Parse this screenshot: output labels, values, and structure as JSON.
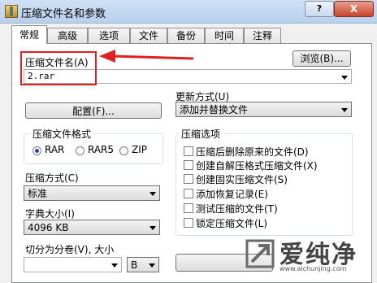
{
  "window": {
    "title": "压缩文件名和参数",
    "help_label": "?",
    "close_label": "X"
  },
  "tabs": [
    "常规",
    "高级",
    "选项",
    "文件",
    "备份",
    "时间",
    "注释"
  ],
  "archive": {
    "label": "压缩文件名(A)",
    "value": "2.rar",
    "browse_label": "浏览(B)..."
  },
  "update_mode": {
    "label": "更新方式(U)",
    "value": "添加并替换文件"
  },
  "profiles_label": "配置(F)...",
  "format": {
    "title": "压缩文件格式",
    "options": [
      "RAR",
      "RAR5",
      "ZIP"
    ],
    "selected": "RAR"
  },
  "method": {
    "label": "压缩方式(C)",
    "value": "标准"
  },
  "dictionary": {
    "label": "字典大小(I)",
    "value": "4096 KB"
  },
  "split": {
    "label": "切分为分卷(V), 大小",
    "value": "",
    "unit": "B"
  },
  "options": {
    "title": "压缩选项",
    "items": [
      "压缩后删除原来的文件(D)",
      "创建自解压格式压缩文件(X)",
      "创建固实压缩文件(S)",
      "添加恢复记录(E)",
      "测试压缩的文件(T)",
      "锁定压缩文件(L)"
    ]
  },
  "watermark": {
    "text": "爱纯净",
    "url": "www.aichunjing.com"
  },
  "colors": {
    "annotation": "#e02020",
    "titlebar": "#c4d8f0"
  }
}
